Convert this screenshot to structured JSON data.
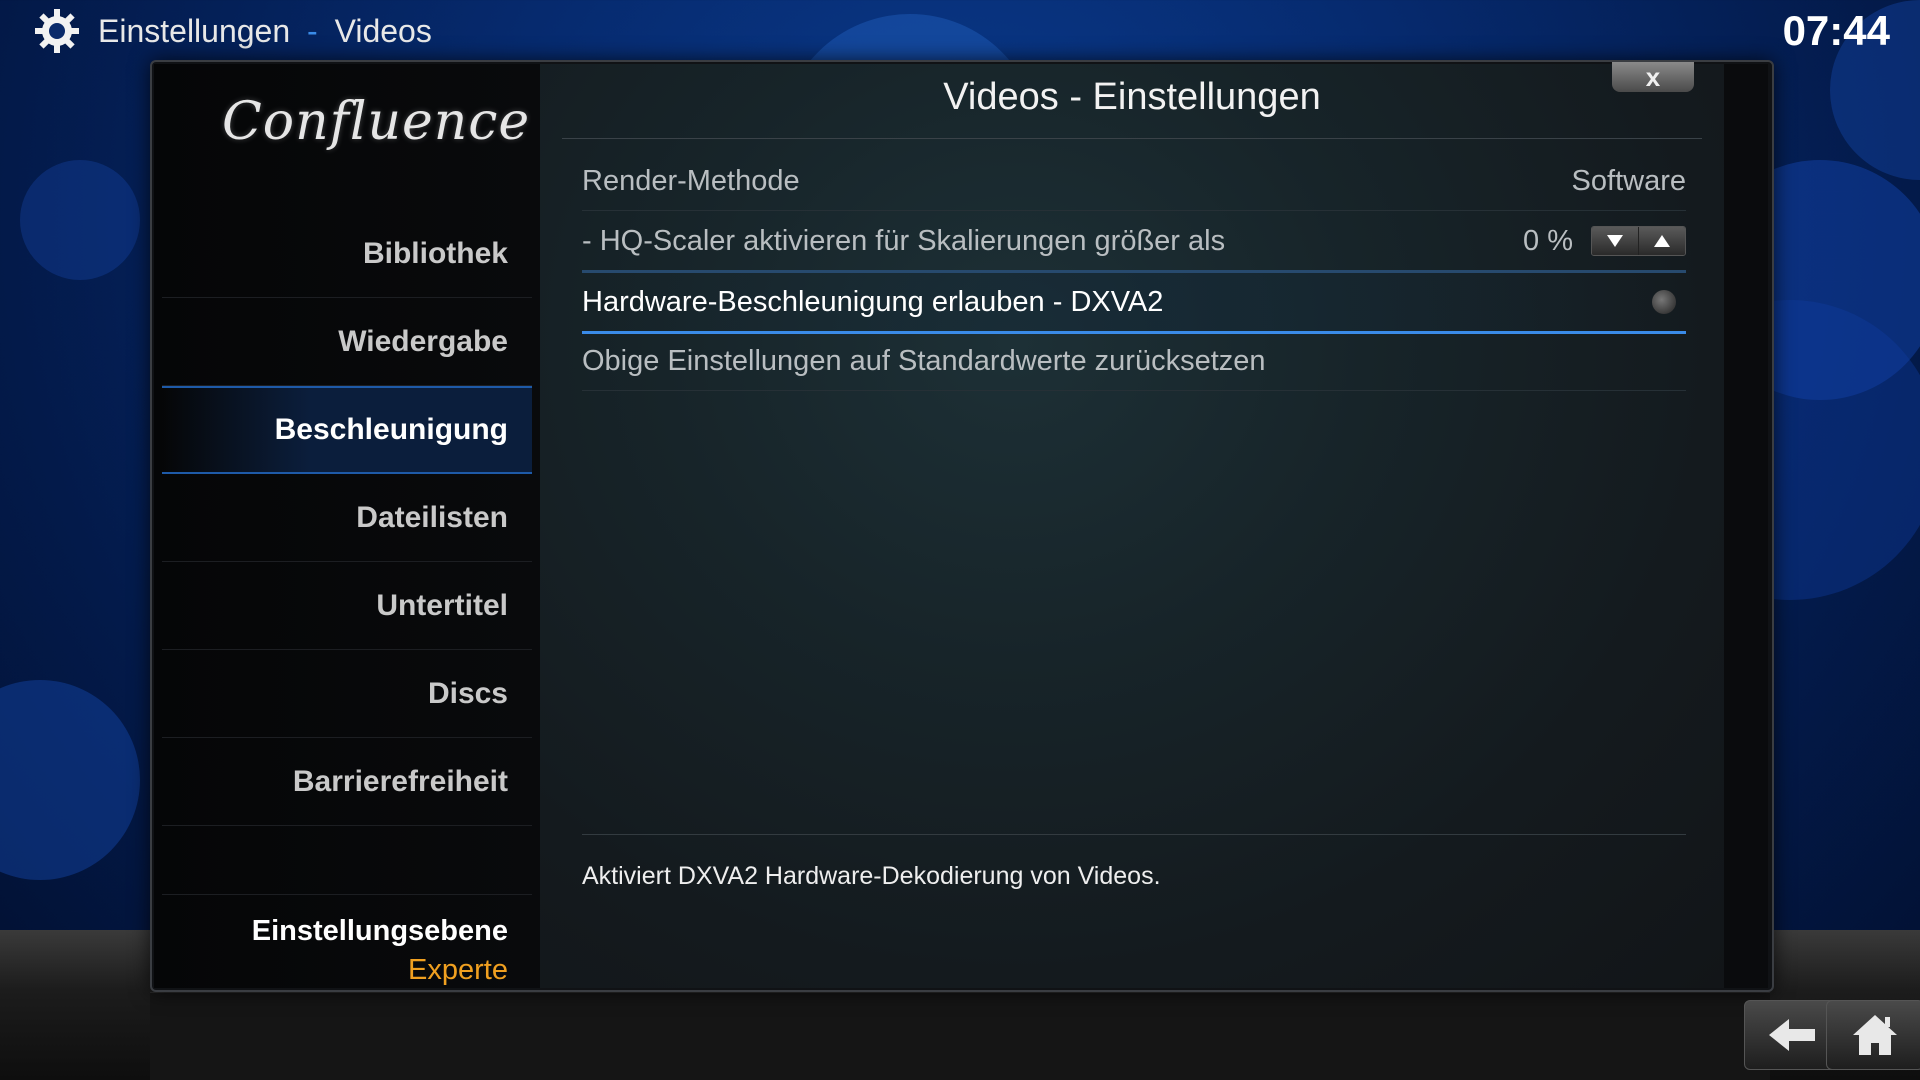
{
  "header": {
    "section": "Einstellungen",
    "separator": "-",
    "page": "Videos",
    "clock": "07:44"
  },
  "sidebar": {
    "logo": "Confluence",
    "items": [
      {
        "label": "Bibliothek"
      },
      {
        "label": "Wiedergabe"
      },
      {
        "label": "Beschleunigung"
      },
      {
        "label": "Dateilisten"
      },
      {
        "label": "Untertitel"
      },
      {
        "label": "Discs"
      },
      {
        "label": "Barrierefreiheit"
      }
    ],
    "selected_index": 2,
    "level_label": "Einstellungsebene",
    "level_value": "Experte"
  },
  "dialog": {
    "title": "Videos - Einstellungen",
    "close_label": "x"
  },
  "settings": [
    {
      "label": "Render-Methode",
      "value": "Software"
    },
    {
      "label": "- HQ-Scaler aktivieren für Skalierungen größer als",
      "value": "0 %"
    },
    {
      "label": "Hardware-Beschleunigung erlauben - DXVA2",
      "toggle": false
    },
    {
      "label": "Obige Einstellungen auf Standardwerte zurücksetzen"
    }
  ],
  "description": "Aktiviert DXVA2 Hardware-Dekodierung von Videos.",
  "colors": {
    "accent": "#3a8be8",
    "level_value": "#f0a020"
  },
  "icons": {
    "header": "gear-icon",
    "back": "back-arrow-icon",
    "home": "home-icon"
  }
}
